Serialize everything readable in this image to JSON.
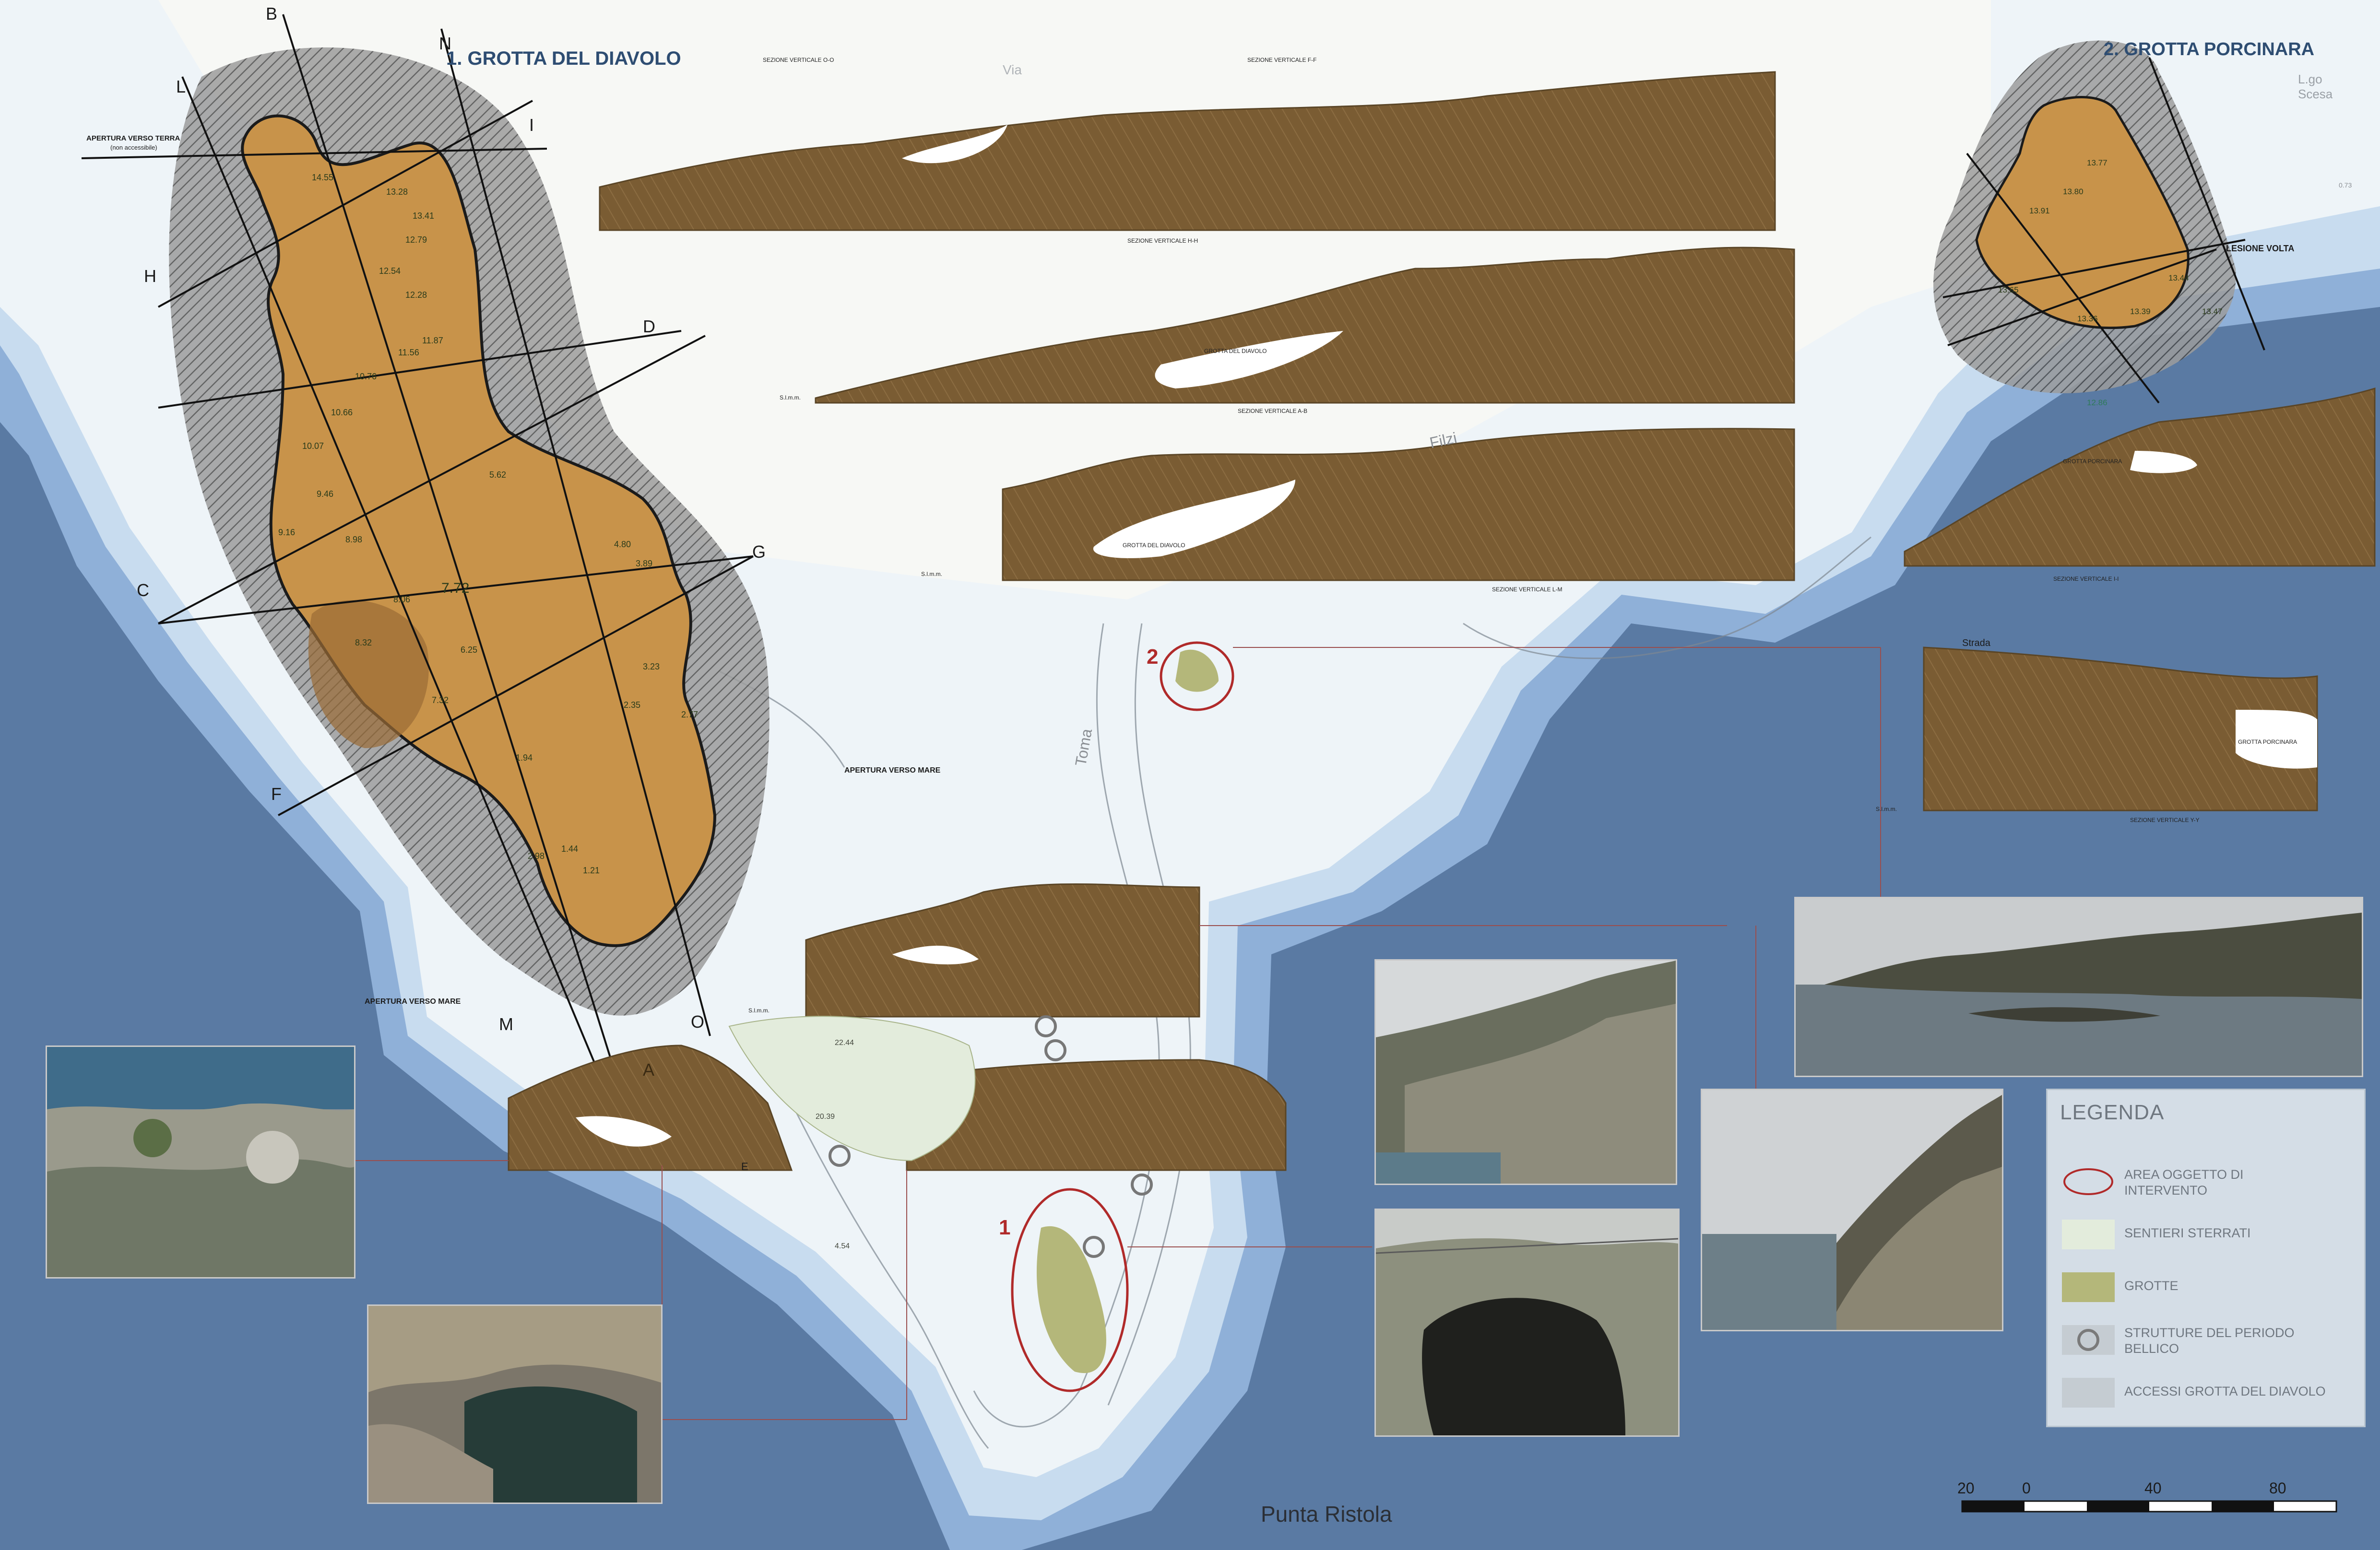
{
  "titles": {
    "grotta_diavolo": "1. GROTTA DEL DIAVOLO",
    "grotta_porcinara": "2. GROTTA PORCINARA"
  },
  "place_name": "Punta Ristola",
  "street_labels": [
    "Filzi",
    "Toma",
    "L.go Scesa",
    "Via"
  ],
  "section_letters": [
    "B",
    "N",
    "L",
    "I",
    "H",
    "D",
    "G",
    "C",
    "F",
    "M",
    "O",
    "A",
    "E"
  ],
  "annotations": {
    "apertura_terra": "APERTURA VERSO TERRA",
    "apertura_terra_note": "(non accessibile)",
    "apertura_mare_1": "APERTURA VERSO MARE",
    "apertura_mare_2": "APERTURA VERSO MARE",
    "lesione_volta": "LESIONE VOLTA",
    "strada": "Strada",
    "slm": "S.l.m.m.",
    "grotta_diavolo_lbl": "GROTTA DEL DIAVOLO",
    "grotta_porcinara_lbl": "GROTTA PORCINARA"
  },
  "section_titles": {
    "s1": "SEZIONE VERTICALE O-O",
    "s2": "SEZIONE VERTICALE F-F",
    "s3": "SEZIONE VERTICALE H-H",
    "s4": "SEZIONE VERTICALE A-B",
    "s5": "SEZIONE VERTICALE L-M",
    "s6": "SEZIONE VERTICALE I-I",
    "s7": "SEZIONE VERTICALE Y-Y"
  },
  "site_markers": [
    "1",
    "2"
  ],
  "spot_heights": [
    "14.55",
    "13.28",
    "13.41",
    "12.79",
    "12.54",
    "12.28",
    "11.87",
    "11.56",
    "10.76",
    "10.66",
    "10.07",
    "9.46",
    "9.16",
    "8.98",
    "8.32",
    "8.06",
    "7.72",
    "7.32",
    "6.25",
    "5.62",
    "4.80",
    "3.89",
    "3.23",
    "2.98",
    "2.77",
    "2.35",
    "1.94",
    "1.44",
    "1.21",
    "0.73",
    "13.77",
    "13.80",
    "13.91",
    "13.65",
    "13.44",
    "13.47",
    "13.39",
    "13.36",
    "12.86",
    "22.44",
    "20.39",
    "4.54"
  ],
  "legend": {
    "title": "LEGENDA",
    "items": [
      {
        "label": "AREA OGGETTO DI INTERVENTO",
        "type": "ellipse"
      },
      {
        "label": "SENTIERI STERRATI",
        "type": "fill",
        "color": "#e3ecdc"
      },
      {
        "label": "GROTTE",
        "type": "fill",
        "color": "#b4b77a"
      },
      {
        "label": "STRUTTURE DEL PERIODO BELLICO",
        "type": "ring"
      },
      {
        "label": "ACCESSI GROTTA DEL DIAVOLO",
        "type": "fill",
        "color": "#c5ccd2"
      }
    ]
  },
  "scale_bar": {
    "ticks": [
      "20",
      "0",
      "40",
      "80"
    ]
  },
  "colors": {
    "sea_deep": "#5a7aa3",
    "sea_mid": "#8fb0d8",
    "sea_shallow": "#c8dcef",
    "land": "#eef4f8",
    "rock_section": "#7a5c33",
    "cave_plan": "#c8934a",
    "intervention": "#b02a2a"
  }
}
